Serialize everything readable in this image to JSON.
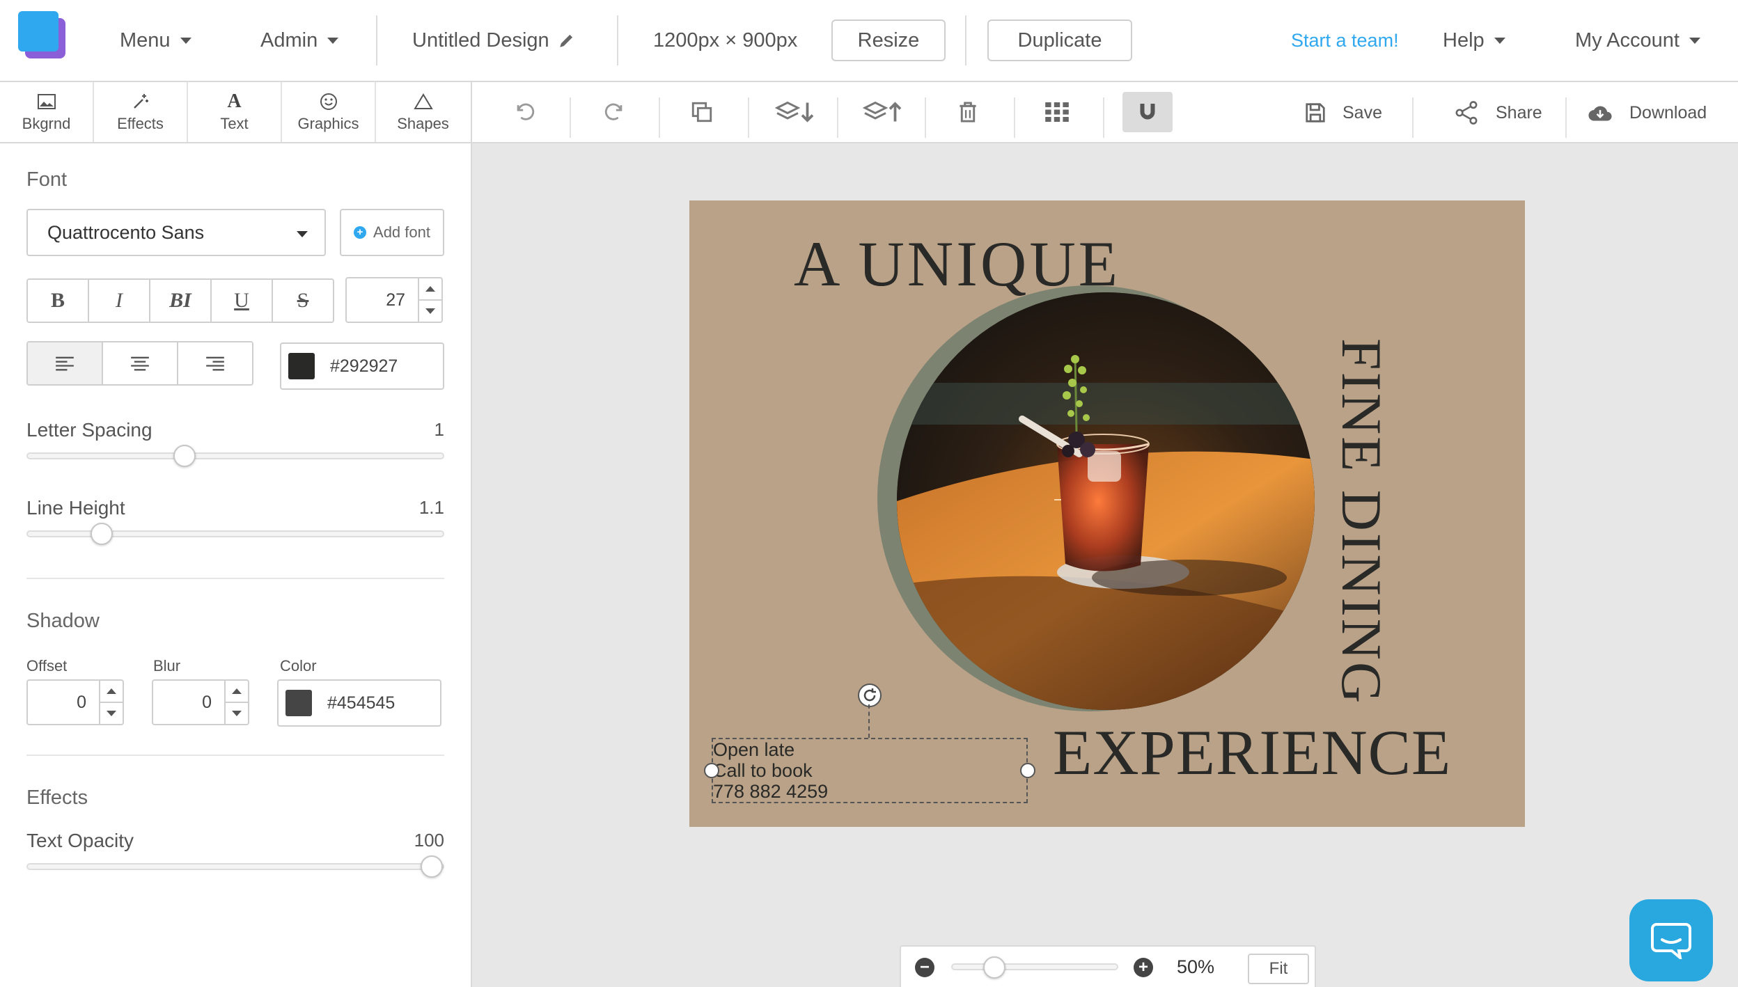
{
  "topbar": {
    "menu_label": "Menu",
    "admin_label": "Admin",
    "design_title": "Untitled Design",
    "dimensions": "1200px × 900px",
    "resize_label": "Resize",
    "duplicate_label": "Duplicate",
    "start_team_label": "Start a team!",
    "help_label": "Help",
    "account_label": "My Account"
  },
  "left_tabs": [
    {
      "label": "Bkgrnd",
      "icon": "image-icon"
    },
    {
      "label": "Effects",
      "icon": "magic-wand-icon"
    },
    {
      "label": "Text",
      "icon": "text-icon"
    },
    {
      "label": "Graphics",
      "icon": "smiley-icon"
    },
    {
      "label": "Shapes",
      "icon": "triangle-icon"
    }
  ],
  "toolbar": {
    "save_label": "Save",
    "share_label": "Share",
    "download_label": "Download",
    "tools": [
      "undo-icon",
      "redo-icon",
      "copy-icon",
      "layer-down-icon",
      "layer-up-icon",
      "trash-icon",
      "grid-icon",
      "magnet-icon"
    ]
  },
  "panel": {
    "font_title": "Font",
    "font_family": "Quattrocento Sans",
    "add_font_label": "Add font",
    "style_buttons": [
      "B",
      "I",
      "BI",
      "U",
      "S"
    ],
    "font_size": "27",
    "text_color": "#292927",
    "letter_spacing_label": "Letter Spacing",
    "letter_spacing_value": "1",
    "letter_spacing_level": 0.37,
    "line_height_label": "Line Height",
    "line_height_value": "1.1",
    "line_height_level": 0.16,
    "shadow_title": "Shadow",
    "offset_label": "Offset",
    "offset_value": "0",
    "blur_label": "Blur",
    "blur_value": "0",
    "shadow_color_label": "Color",
    "shadow_color": "#454545",
    "effects_title": "Effects",
    "opacity_label": "Text Opacity",
    "opacity_value": "100",
    "opacity_level": 1.0
  },
  "canvas": {
    "background_color": "#b9a287",
    "heading_top": "A UNIQUE",
    "heading_side": "FINE DINING",
    "heading_bottom": "EXPERIENCE",
    "selected_text": "Open late\nCall to book\n778 882 4259"
  },
  "zoom": {
    "value": "50%",
    "fit_label": "Fit"
  },
  "colors": {
    "accent": "#2fa8ef",
    "chat": "#29a8e0"
  }
}
